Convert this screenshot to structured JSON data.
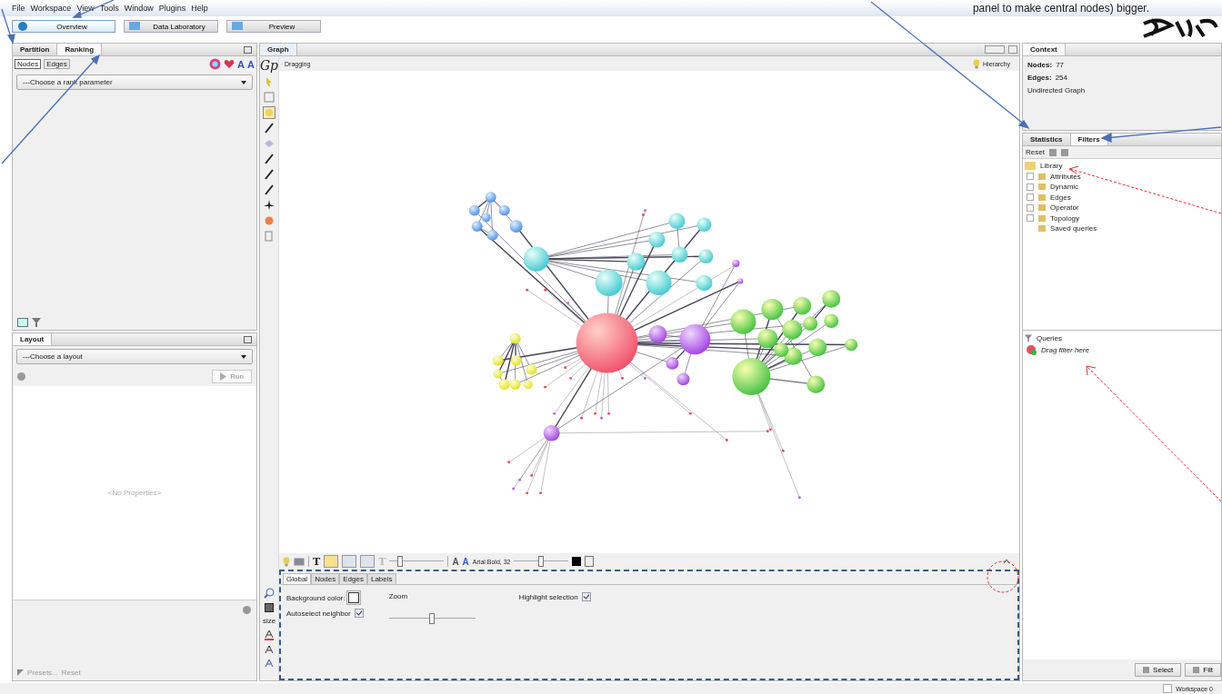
{
  "annotation": {
    "text": "panel to make central nodes) bigger."
  },
  "menu": [
    "File",
    "Workspace",
    "View",
    "Tools",
    "Window",
    "Plugins",
    "Help"
  ],
  "perspectives": [
    {
      "label": "Overview",
      "selected": true
    },
    {
      "label": "Data Laboratory",
      "selected": false
    },
    {
      "label": "Preview",
      "selected": false
    }
  ],
  "ranking_panel": {
    "tabs": [
      {
        "label": "Partition",
        "selected": false
      },
      {
        "label": "Ranking",
        "selected": true
      }
    ],
    "subtabs": [
      {
        "label": "Nodes",
        "selected": true
      },
      {
        "label": "Edges",
        "selected": false
      }
    ],
    "dropdown": "---Choose a rank parameter",
    "icon_glyphs": [
      "A",
      "A"
    ]
  },
  "layout_panel": {
    "title": "Layout",
    "dropdown": "---Choose a layout",
    "run_button": "Run",
    "empty_text": "<No Properties>",
    "presets": "Presets...",
    "reset": "Reset"
  },
  "graph_panel": {
    "tab": "Graph",
    "logo_glyph": "Gp",
    "toolbar_glyphs": [
      "T",
      "T",
      "A",
      "A"
    ],
    "mode": "Dragging",
    "hierarchy": "Hierarchy",
    "size_tool": "size",
    "edge_scale": {
      "level": 0.2
    },
    "font_label": "Arial Bold, 32",
    "font_size": {
      "level": 0.5
    },
    "tabs": [
      {
        "label": "Global",
        "selected": true
      },
      {
        "label": "Nodes",
        "selected": false
      },
      {
        "label": "Edges",
        "selected": false
      },
      {
        "label": "Labels",
        "selected": false
      }
    ],
    "background_color_label": "Background color:",
    "zoom_label": "Zoom",
    "zoom": {
      "level": 0.5
    },
    "highlight_selection": {
      "label": "Highlight selection",
      "checked": true
    },
    "autoselect_neighbor": {
      "label": "Autoselect neighbor",
      "checked": true
    }
  },
  "context_panel": {
    "title": "Context",
    "nodes_label": "Nodes:",
    "nodes": "77",
    "edges_label": "Edges:",
    "edges": "254",
    "graph_type": "Undirected Graph"
  },
  "filters_panel": {
    "tabs": [
      {
        "label": "Statistics",
        "selected": false
      },
      {
        "label": "Filters",
        "selected": true
      }
    ],
    "reset": "Reset",
    "library": "Library",
    "items": [
      {
        "label": "Attributes",
        "kind": "group"
      },
      {
        "label": "Dynamic",
        "kind": "group"
      },
      {
        "label": "Edges",
        "kind": "group"
      },
      {
        "label": "Operator",
        "kind": "group"
      },
      {
        "label": "Topology",
        "kind": "group"
      },
      {
        "label": "Saved queries",
        "kind": "leaf"
      }
    ],
    "queries": "Queries",
    "drop_hint": "Drag filter here",
    "buttons": [
      "Select",
      "Filt"
    ]
  },
  "status_bar": {
    "checked": false,
    "workspace": "Workspace 0"
  }
}
